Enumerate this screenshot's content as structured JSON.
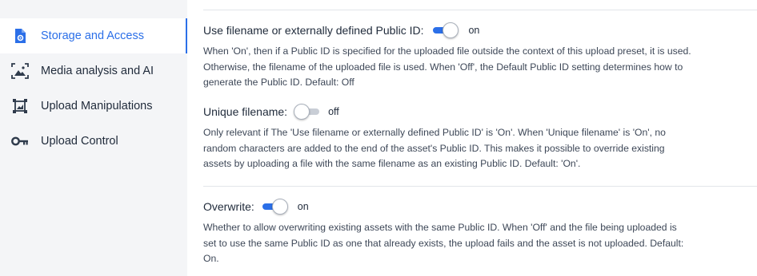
{
  "sidebar": {
    "items": [
      {
        "label": "Storage and Access",
        "icon": "storage-access-icon",
        "active": true
      },
      {
        "label": "Media analysis and AI",
        "icon": "media-analysis-icon",
        "active": false
      },
      {
        "label": "Upload Manipulations",
        "icon": "upload-manipulations-icon",
        "active": false
      },
      {
        "label": "Upload Control",
        "icon": "key-icon",
        "active": false
      }
    ]
  },
  "settings": {
    "use_filename": {
      "label": "Use filename or externally defined Public ID:",
      "state": "on",
      "description": "When 'On', then if a Public ID is specified for the uploaded file outside the context of this upload preset, it is used. Otherwise, the filename of the uploaded file is used. When 'Off', the Default Public ID setting determines how to generate the Public ID. Default: Off"
    },
    "unique_filename": {
      "label": "Unique filename:",
      "state": "off",
      "description": "Only relevant if The 'Use filename or externally defined Public ID' is 'On'. When 'Unique filename' is 'On', no random characters are added to the end of the asset's Public ID. This makes it possible to override existing assets by uploading a file with the same filename as an existing Public ID. Default: 'On'."
    },
    "overwrite": {
      "label": "Overwrite:",
      "state": "on",
      "description": "Whether to allow overwriting existing assets with the same Public ID. When 'Off' and the file being uploaded is set to use the same Public ID as one that already exists, the upload fails and the asset is not uploaded. Default: On."
    }
  },
  "colors": {
    "accent": "#2b6fe8",
    "sidebar_bg": "#f4f5f7",
    "text": "#1f2a3a"
  }
}
